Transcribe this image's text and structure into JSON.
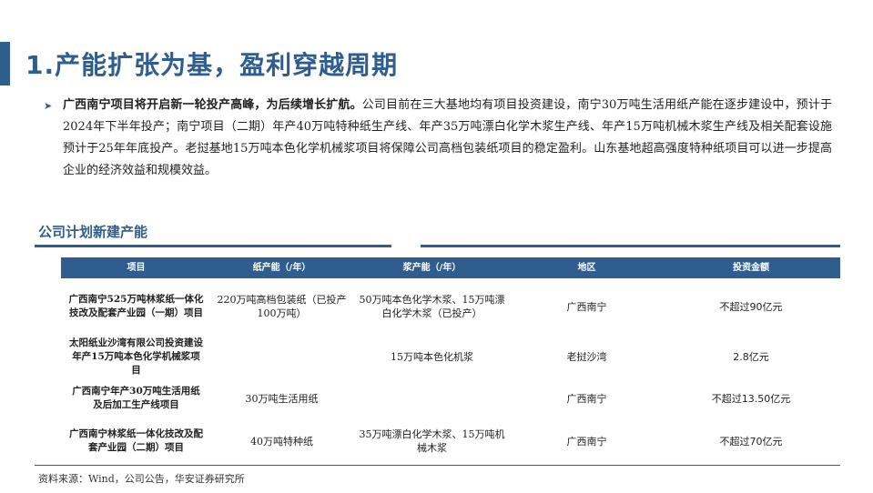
{
  "title": "1.产能扩张为基，盈利穿越周期",
  "bullet": {
    "lead": "广西南宁项目将开启新一轮投产高峰，为后续增长扩航。",
    "text": "公司目前在三大基地均有项目投资建设，南宁30万吨生活用纸产能在逐步建设中，预计于2024年下半年投产；南宁项目（二期）年产40万吨特种纸生产线、年产35万吨漂白化学木浆生产线、年产15万吨机械木浆生产线及相关配套设施预计于25年年底投产。老挝基地15万吨本色化学机械浆项目将保障公司高档包装纸项目的稳定盈利。山东基地超高强度特种纸项目可以进一步提高企业的经济效益和规模效益。"
  },
  "table": {
    "title": "公司计划新建产能",
    "headers": [
      "项目",
      "纸产能（/年）",
      "浆产能（/年）",
      "地区",
      "投资金额"
    ],
    "rows": [
      [
        "广西南宁525万吨林浆纸一体化技改及配套产业园（一期）项目",
        "220万吨高档包装纸（已投产100万吨）",
        "50万吨本色化学木浆、15万吨漂白化学木浆（已投产）",
        "广西南宁",
        "不超过90亿元"
      ],
      [
        "太阳纸业沙湾有限公司投资建设年产15万吨本色化学机械浆项目",
        "",
        "15万吨本色化机浆",
        "老挝沙湾",
        "2.8亿元"
      ],
      [
        "广西南宁年产30万吨生活用纸及后加工生产线项目",
        "30万吨生活用纸",
        "",
        "广西南宁",
        "不超过13.50亿元"
      ],
      [
        "广西南宁林浆纸一体化技改及配套产业园（二期）项目",
        "40万吨特种纸",
        "35万吨漂白化学木浆、15万吨机械木浆",
        "广西南宁",
        "不超过70亿元"
      ]
    ]
  },
  "source": "资料来源：Wind，公司公告，华安证券研究所",
  "colors": {
    "accent": "#2f5d8e"
  }
}
